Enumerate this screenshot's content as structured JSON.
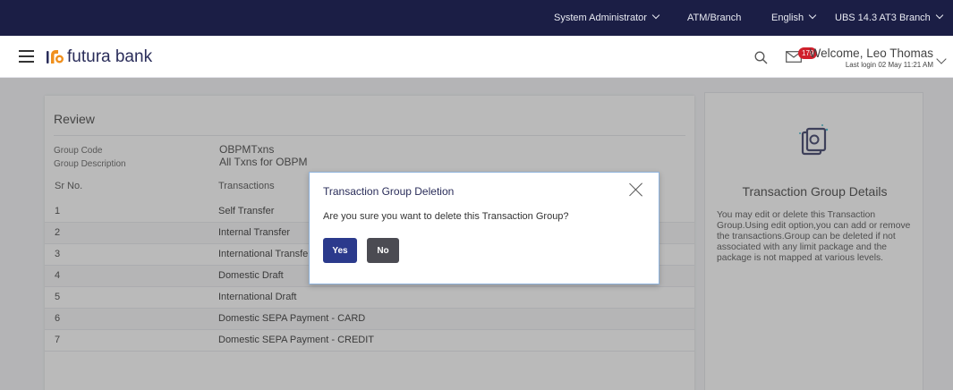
{
  "topbar": {
    "role": "System Administrator",
    "branch_type": "ATM/Branch",
    "language": "English",
    "branch": "UBS 14.3 AT3 Branch"
  },
  "header": {
    "brand": "futura bank",
    "notification_count": "179",
    "welcome": "Welcome, Leo Thomas",
    "last_login": "Last login 02 May 11:21 AM"
  },
  "review": {
    "title": "Review",
    "group_code_label": "Group Code",
    "group_code_value": "OBPMTxns",
    "group_desc_label": "Group Description",
    "group_desc_value": "All Txns for OBPM",
    "columns": [
      "Sr No.",
      "Transactions"
    ],
    "rows": [
      {
        "sr": "1",
        "txn": "Self Transfer"
      },
      {
        "sr": "2",
        "txn": "Internal Transfer"
      },
      {
        "sr": "3",
        "txn": "International Transfer"
      },
      {
        "sr": "4",
        "txn": "Domestic Draft"
      },
      {
        "sr": "5",
        "txn": "International Draft"
      },
      {
        "sr": "6",
        "txn": "Domestic SEPA Payment - CARD"
      },
      {
        "sr": "7",
        "txn": "Domestic SEPA Payment - CREDIT"
      }
    ]
  },
  "side_panel": {
    "title": "Transaction Group Details",
    "description": "You may edit or delete this Transaction Group.Using edit option,you can add or remove the transactions.Group can be deleted if not associated with any limit package and the package is not mapped at various levels."
  },
  "modal": {
    "title": "Transaction Group Deletion",
    "message": "Are you sure you want to delete this Transaction Group?",
    "yes_label": "Yes",
    "no_label": "No"
  },
  "colors": {
    "topbar": "#1b1e45",
    "primary_button": "#2b3a8c",
    "secondary_button": "#4b4b52",
    "badge": "#d0202c",
    "logo_orange": "#f0901e"
  }
}
